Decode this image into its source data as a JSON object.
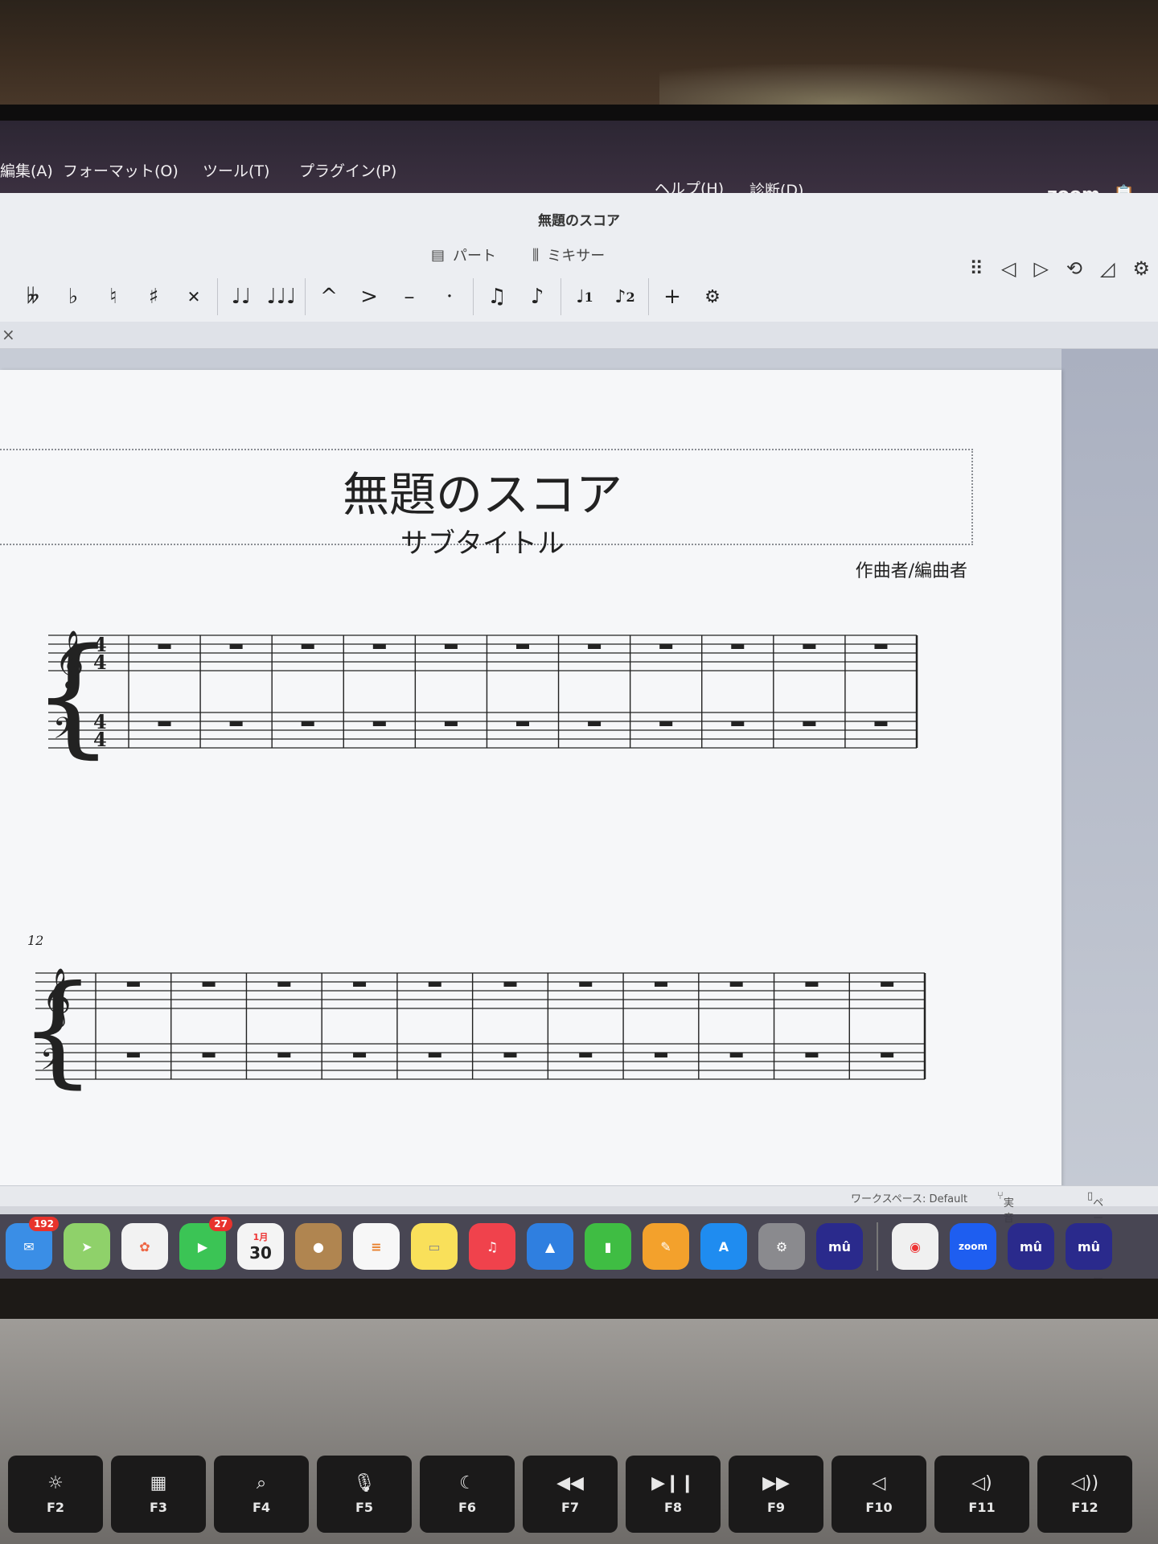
{
  "menubar": {
    "items": [
      "編集(A)",
      "フォーマット(O)",
      "ツール(T)",
      "プラグイン(P)",
      "ヘルプ(H)",
      "診断(D)"
    ],
    "zoom": "zoom"
  },
  "window": {
    "title": "無題のスコア",
    "view_parts": "パート",
    "view_mixer": "ミキサー"
  },
  "toolbar": {
    "buttons": [
      "double-flat",
      "flat",
      "natural",
      "sharp",
      "double-sharp",
      "tie",
      "slur",
      "marcato",
      "accent",
      "tenuto",
      "staccato",
      "tuplet",
      "flip-direction",
      "voice-1",
      "voice-2",
      "add",
      "customize"
    ],
    "voice1": "1",
    "voice2": "2"
  },
  "score": {
    "title": "無題のスコア",
    "subtitle": "サブタイトル",
    "composer": "作曲者/編曲者",
    "time_signature": "4/4",
    "measures_per_system": 11,
    "measure_number_system2": "12"
  },
  "statusbar": {
    "workspace": "ワークスペース: Default",
    "concert_pitch": "実音",
    "page_view": "ページビュー"
  },
  "dock": {
    "mail_badge": "192",
    "facetime_badge": "27",
    "calendar_month": "1月",
    "calendar_day": "30",
    "zoom_label": "zoom"
  },
  "keyboard": {
    "keys": [
      "F2",
      "F3",
      "F4",
      "F5",
      "F6",
      "F7",
      "F8",
      "F9",
      "F10",
      "F11",
      "F12"
    ]
  }
}
